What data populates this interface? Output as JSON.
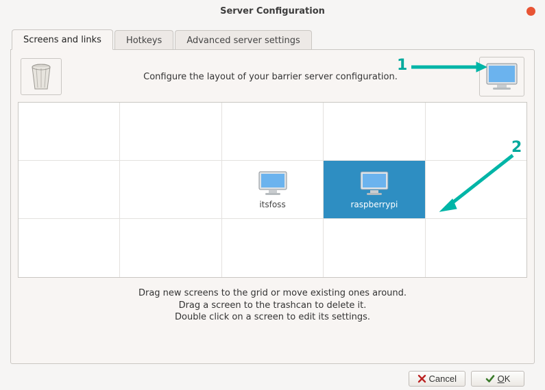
{
  "window": {
    "title": "Server Configuration"
  },
  "tabs": {
    "screens": "Screens and links",
    "hotkeys": "Hotkeys",
    "advanced": "Advanced server settings"
  },
  "top": {
    "instruction": "Configure the layout of your barrier server configuration."
  },
  "grid": {
    "itsfoss": "itsfoss",
    "raspberrypi": "raspberrypi"
  },
  "hints": {
    "line1": "Drag new screens to the grid or move existing ones around.",
    "line2": "Drag a screen to the trashcan to delete it.",
    "line3": "Double click on a screen to edit its settings."
  },
  "annotations": {
    "num1": "1",
    "num2": "2"
  },
  "buttons": {
    "cancel": "Cancel",
    "ok": "OK"
  }
}
